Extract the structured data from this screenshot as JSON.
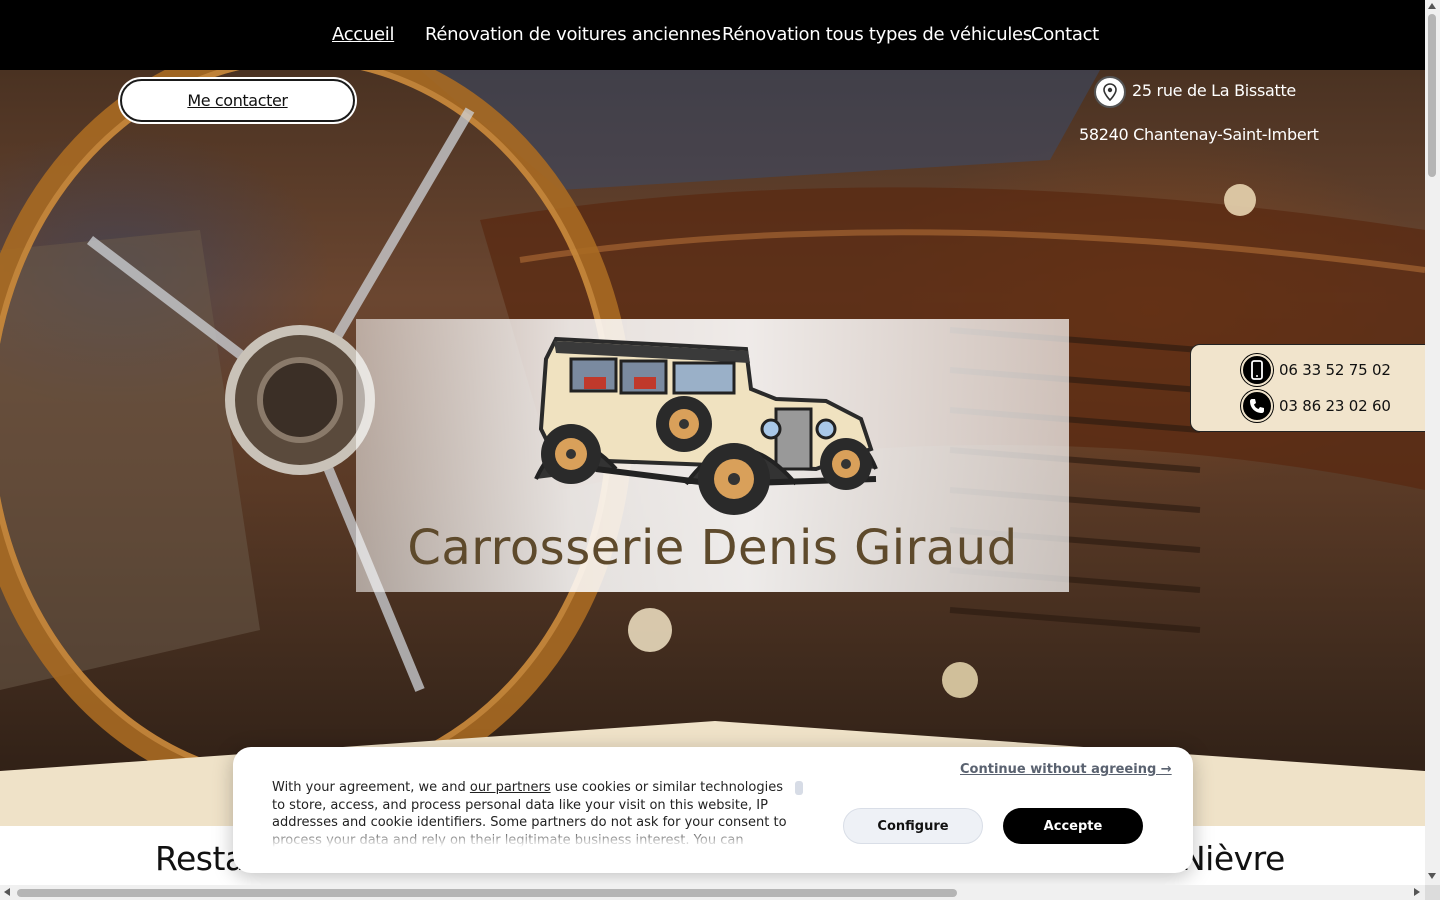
{
  "nav": {
    "items": [
      {
        "label": "Accueil",
        "active": true
      },
      {
        "label": "Rénovation de voitures anciennes",
        "active": false
      },
      {
        "label": "Rénovation tous types de véhicules",
        "active": false
      },
      {
        "label": "Contact",
        "active": false
      }
    ]
  },
  "hero": {
    "contact_button": "Me contacter",
    "address_line1": "25 rue de La Bissatte",
    "address_line2": "58240 Chantenay-Saint-Imbert",
    "phones": [
      "06 33 52 75 02",
      "03 86 23 02 60"
    ],
    "brand_title": "Carrosserie Denis Giraud",
    "icons": {
      "address": "location-pin-icon",
      "mobile": "mobile-phone-icon",
      "landline": "phone-handset-icon"
    }
  },
  "section": {
    "heading_left": "Resta",
    "heading_right": "Nièvre"
  },
  "cookie_banner": {
    "text_prefix": "With your agreement, we and ",
    "partners_link": "our partners",
    "text_suffix": " use cookies or similar technologies to store, access, and process personal data like your visit on this website, IP addresses and cookie identifiers. Some partners do not ask for your consent to process your data and rely on their legitimate business interest. You can",
    "continue_link": "Continue without agreeing →",
    "configure_button": "Configure",
    "accept_button": "Accepte"
  },
  "colors": {
    "nav_bg": "#000000",
    "brand_text": "#5e4a2c",
    "phone_box_bg": "#f1e4cc",
    "wave": "#efe2c8"
  }
}
